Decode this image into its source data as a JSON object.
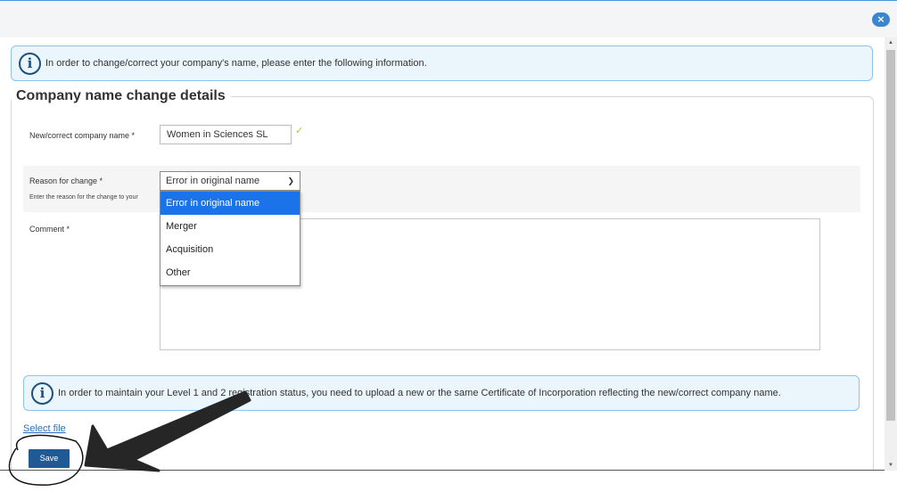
{
  "window": {
    "close_label": "×"
  },
  "info": {
    "icon": "info-circle-icon",
    "text": "In order to change/correct your company's name, please enter the following information."
  },
  "form": {
    "legend": "Company name change details",
    "name_label": "New/correct company name *",
    "name_value": "Women in Sciences SL",
    "name_valid_mark": "✓",
    "reason_label": "Reason for change *",
    "reason_help": "Enter the reason for the change to your",
    "reason_selected": "Error in original name",
    "reason_options": [
      "Error in original name",
      "Merger",
      "Acquisition",
      "Other"
    ],
    "comment_label": "Comment *",
    "comment_value": ""
  },
  "upload_notice": {
    "text": "In order to maintain your Level 1 and 2 registration status, you need to upload a new or the same Certificate of Incorporation reflecting the new/correct company name."
  },
  "actions": {
    "select_file": "Select file",
    "save": "Save"
  },
  "colors": {
    "accent": "#1f5a96",
    "info_bg": "#eaf5fc",
    "info_border": "#8fc2e6",
    "dropdown_highlight": "#1a73e8",
    "valid_check": "#a8c81e"
  }
}
